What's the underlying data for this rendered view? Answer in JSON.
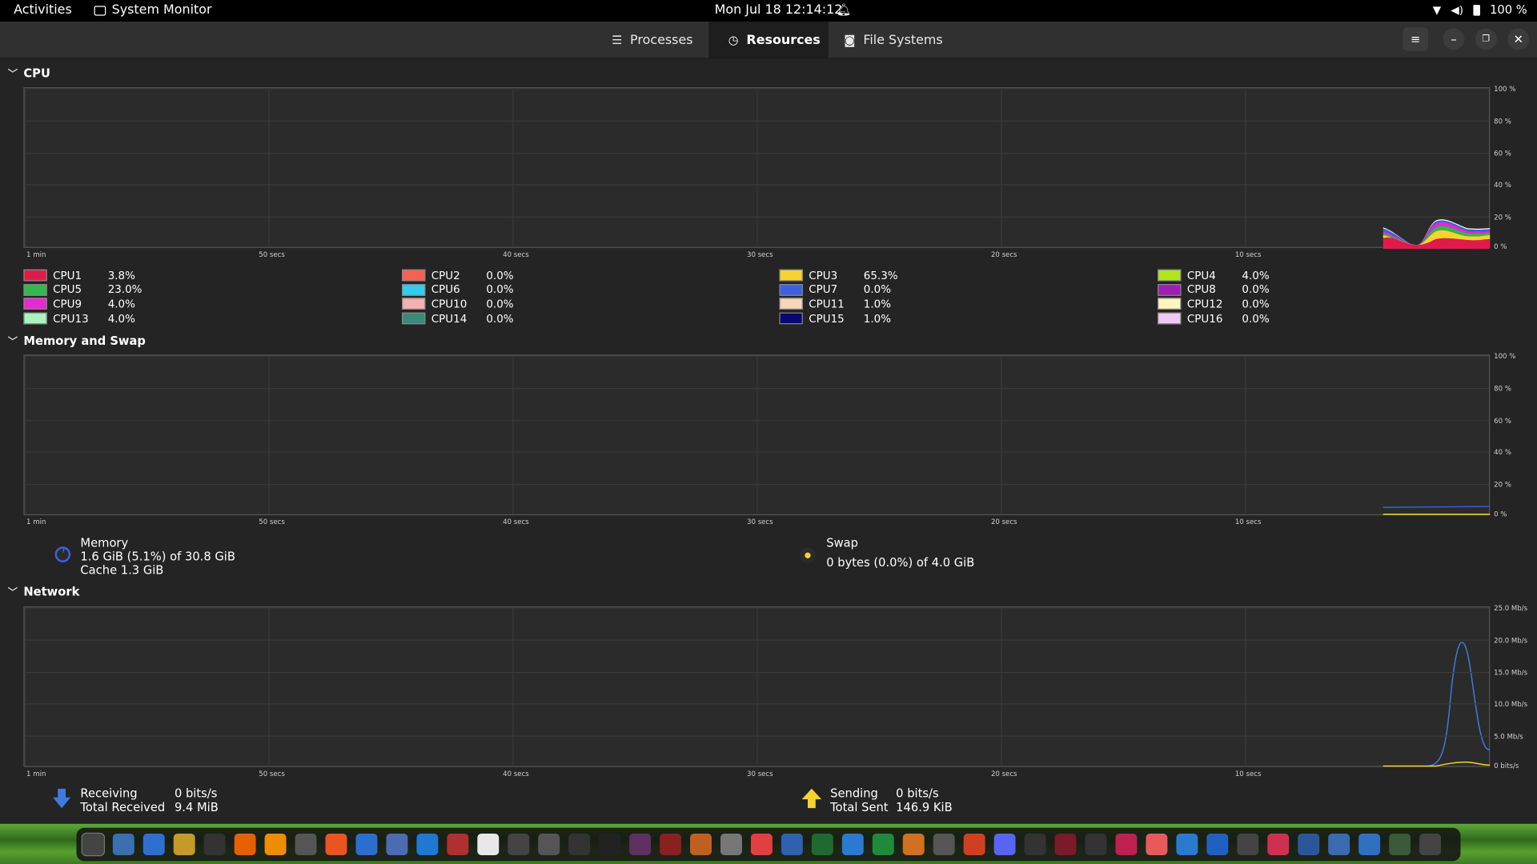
{
  "topbar": {
    "activities": "Activities",
    "app_name": "System Monitor",
    "datetime": "Mon Jul 18  12:14:12",
    "battery": "100 %"
  },
  "tabs": [
    {
      "label": "Processes",
      "icon": "list-icon"
    },
    {
      "label": "Resources",
      "icon": "gauge-icon",
      "active": true
    },
    {
      "label": "File Systems",
      "icon": "disk-icon"
    }
  ],
  "cpu": {
    "title": "CPU",
    "y_ticks": [
      "100 %",
      "80 %",
      "60 %",
      "40 %",
      "20 %",
      "0 %"
    ],
    "legend": [
      {
        "name": "CPU1",
        "value": "3.8%",
        "color": "#e01b4c"
      },
      {
        "name": "CPU2",
        "value": "0.0%",
        "color": "#f66151"
      },
      {
        "name": "CPU3",
        "value": "65.3%",
        "color": "#f6d32d"
      },
      {
        "name": "CPU4",
        "value": "4.0%",
        "color": "#b0e51b"
      },
      {
        "name": "CPU5",
        "value": "23.0%",
        "color": "#33b84d"
      },
      {
        "name": "CPU6",
        "value": "0.0%",
        "color": "#33ccf0"
      },
      {
        "name": "CPU7",
        "value": "0.0%",
        "color": "#3d60de"
      },
      {
        "name": "CPU8",
        "value": "0.0%",
        "color": "#9b1fb0"
      },
      {
        "name": "CPU9",
        "value": "4.0%",
        "color": "#e629d1"
      },
      {
        "name": "CPU10",
        "value": "0.0%",
        "color": "#f5b0b0"
      },
      {
        "name": "CPU11",
        "value": "1.0%",
        "color": "#f8d7b8"
      },
      {
        "name": "CPU12",
        "value": "0.0%",
        "color": "#fff5c0"
      },
      {
        "name": "CPU13",
        "value": "4.0%",
        "color": "#a8f5c0"
      },
      {
        "name": "CPU14",
        "value": "0.0%",
        "color": "#3a8a7a"
      },
      {
        "name": "CPU15",
        "value": "1.0%",
        "color": "#080870"
      },
      {
        "name": "CPU16",
        "value": "0.0%",
        "color": "#f0c8f5"
      }
    ]
  },
  "x_ticks": [
    "1 min",
    "50 secs",
    "40 secs",
    "30 secs",
    "20 secs",
    "10 secs"
  ],
  "memory": {
    "title": "Memory and Swap",
    "y_ticks": [
      "100 %",
      "80 %",
      "60 %",
      "40 %",
      "20 %",
      "0 %"
    ],
    "mem_label": "Memory",
    "mem_line": "1.6 GiB (5.1%) of 30.8 GiB",
    "cache_line": "Cache 1.3 GiB",
    "swap_label": "Swap",
    "swap_line": "0 bytes (0.0%) of 4.0 GiB",
    "mem_color": "#3d60de",
    "swap_color": "#f6d32d"
  },
  "network": {
    "title": "Network",
    "y_ticks": [
      "25.0 Mb/s",
      "20.0 Mb/s",
      "15.0 Mb/s",
      "10.0 Mb/s",
      "5.0 Mb/s",
      "0 bits/s"
    ],
    "receiving_label": "Receiving",
    "receiving_value": "0 bits/s",
    "total_received_label": "Total Received",
    "total_received_value": "9.4 MiB",
    "sending_label": "Sending",
    "sending_value": "0 bits/s",
    "total_sent_label": "Total Sent",
    "total_sent_value": "146.9 KiB",
    "recv_color": "#3d7be0",
    "send_color": "#f6d32d"
  },
  "dock_icons": [
    "terminal-icon",
    "files-icon",
    "text-editor-icon",
    "archive-icon",
    "console-icon",
    "firefox-icon",
    "vlc-icon",
    "settings-icon",
    "software-icon",
    "notes-icon",
    "screenshot-icon",
    "help-icon",
    "monitor-icon",
    "document-icon",
    "tools-icon",
    "box-icon",
    "obs-icon",
    "inkscape-icon",
    "game-icon",
    "wine-icon",
    "usb-icon",
    "search-icon",
    "chrome-icon",
    "writer-icon",
    "calc-icon",
    "camera-icon",
    "sheets-icon",
    "impress-icon",
    "calendar-icon",
    "pdf-icon",
    "discord-icon",
    "steam-icon",
    "player-icon",
    "stats-icon",
    "record-icon",
    "puzzle-icon",
    "cloud-icon",
    "mail-icon",
    "github-icon",
    "heart-icon",
    "word-icon",
    "scanner-icon",
    "remote-icon",
    "trash-icon",
    "app-grid-icon"
  ]
}
